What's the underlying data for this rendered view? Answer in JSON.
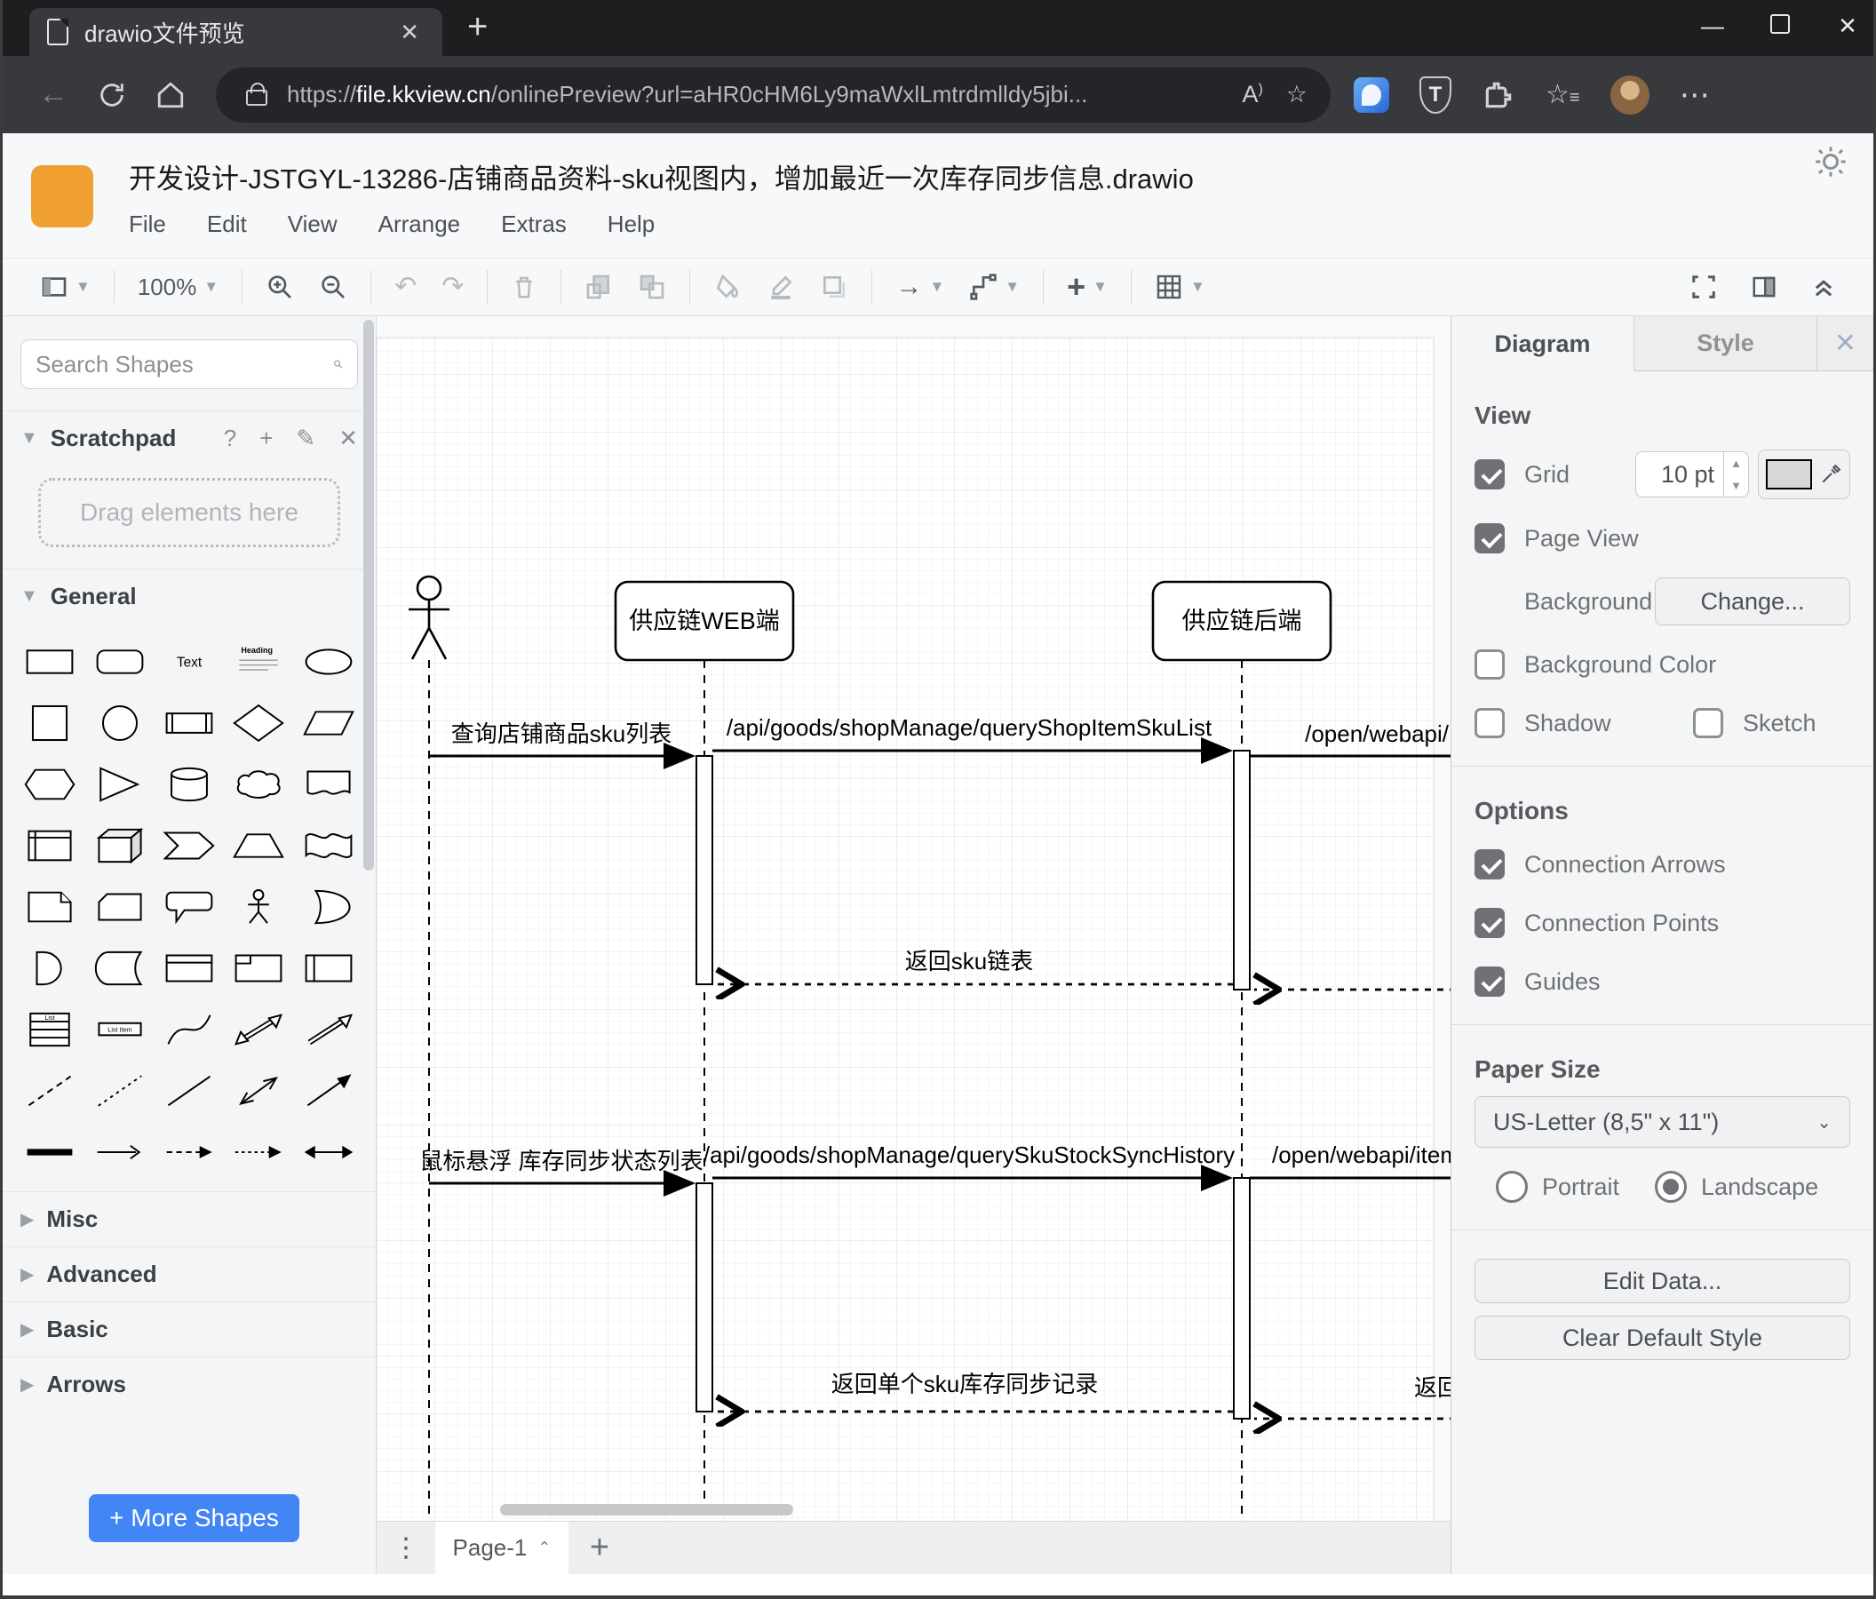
{
  "browser": {
    "tab_title": "drawio文件预览",
    "url": {
      "scheme": "https://",
      "host": "file.kkview.cn",
      "path": "/onlinePreview?url=aHR0cHM6Ly9maWxlLmtrdmlldy5jbi..."
    }
  },
  "app": {
    "title": "开发设计-JSTGYL-13286-店铺商品资料-sku视图内，增加最近一次库存同步信息.drawio",
    "menus": [
      "File",
      "Edit",
      "View",
      "Arrange",
      "Extras",
      "Help"
    ],
    "zoom_level": "100%"
  },
  "sidebar": {
    "search_placeholder": "Search Shapes",
    "scratchpad_title": "Scratchpad",
    "scratchpad_hint": "Drag elements here",
    "sections": [
      {
        "label": "General",
        "expanded": true
      },
      {
        "label": "Misc",
        "expanded": false
      },
      {
        "label": "Advanced",
        "expanded": false
      },
      {
        "label": "Basic",
        "expanded": false
      },
      {
        "label": "Arrows",
        "expanded": false
      }
    ],
    "more_shapes_label": "+ More Shapes",
    "shapes": [
      {
        "name": "rectangle"
      },
      {
        "name": "rounded-rectangle"
      },
      {
        "name": "text",
        "label": "Text"
      },
      {
        "name": "heading",
        "label": "Heading"
      },
      {
        "name": "ellipse"
      },
      {
        "name": "square"
      },
      {
        "name": "circle"
      },
      {
        "name": "process"
      },
      {
        "name": "diamond"
      },
      {
        "name": "parallelogram"
      },
      {
        "name": "hexagon"
      },
      {
        "name": "triangle"
      },
      {
        "name": "cylinder"
      },
      {
        "name": "cloud"
      },
      {
        "name": "document"
      },
      {
        "name": "internal-storage"
      },
      {
        "name": "cube"
      },
      {
        "name": "step"
      },
      {
        "name": "trapezoid"
      },
      {
        "name": "tape"
      },
      {
        "name": "note"
      },
      {
        "name": "card"
      },
      {
        "name": "callout"
      },
      {
        "name": "actor"
      },
      {
        "name": "or"
      },
      {
        "name": "and"
      },
      {
        "name": "data-storage"
      },
      {
        "name": "container"
      },
      {
        "name": "frame"
      },
      {
        "name": "horizontal-container"
      },
      {
        "name": "list",
        "label": "List"
      },
      {
        "name": "list-item",
        "label": "List Item"
      },
      {
        "name": "curve"
      },
      {
        "name": "bidirectional-arrow"
      },
      {
        "name": "arrow"
      },
      {
        "name": "dashed-line"
      },
      {
        "name": "dotted-line"
      },
      {
        "name": "line"
      },
      {
        "name": "bidirectional-connector"
      },
      {
        "name": "directional-connector"
      },
      {
        "name": "link"
      },
      {
        "name": "arrow-connector"
      },
      {
        "name": "dashed-arrow"
      },
      {
        "name": "dotted-arrow"
      },
      {
        "name": "double-arrow"
      }
    ]
  },
  "diagram": {
    "participants": {
      "web": "供应链WEB端",
      "backend": "供应链后端"
    },
    "messages": {
      "m1": "查询店铺商品sku列表",
      "m2": "/api/goods/shopManage/queryShopItemSkuList",
      "m3": "/open/webapi/",
      "r1": "返回sku链表",
      "m4": "鼠标悬浮 库存同步状态列表",
      "m5": "/api/goods/shopManage/querySkuStockSyncHistory",
      "m6": "/open/webapi/item",
      "r2": "返回单个sku库存同步记录",
      "r3": "返回"
    },
    "page_tab": "Page-1"
  },
  "panel": {
    "tabs": {
      "diagram": "Diagram",
      "style": "Style"
    },
    "view": {
      "heading": "View",
      "grid": "Grid",
      "grid_size": "10 pt",
      "page_view": "Page View",
      "background": "Background",
      "change": "Change...",
      "background_color": "Background Color",
      "shadow": "Shadow",
      "sketch": "Sketch"
    },
    "options": {
      "heading": "Options",
      "connection_arrows": "Connection Arrows",
      "connection_points": "Connection Points",
      "guides": "Guides"
    },
    "paper": {
      "heading": "Paper Size",
      "size": "US-Letter (8,5\" x 11\")",
      "portrait": "Portrait",
      "landscape": "Landscape"
    },
    "edit_data": "Edit Data...",
    "clear_default_style": "Clear Default Style"
  },
  "colors": {
    "accent_blue": "#4285f4",
    "logo_orange": "#efa030",
    "chrome_dark": "#1d1e20",
    "panel_gray": "#f4f5f6"
  }
}
